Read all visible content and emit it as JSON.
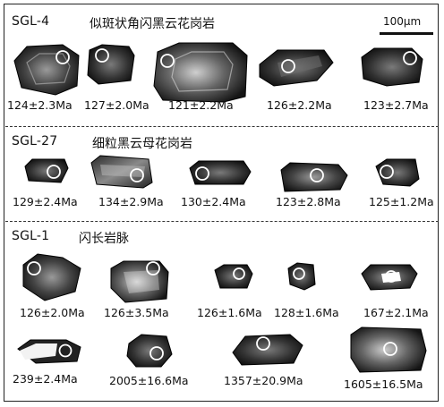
{
  "scale": {
    "label": "100μm"
  },
  "sections": [
    {
      "id": "SGL-4",
      "sample": "SGL-4",
      "rock": "似斑状角闪黑云花岗岩",
      "ages": [
        "124±2.3Ma",
        "127±2.0Ma",
        "121±2.2Ma",
        "126±2.2Ma",
        "123±2.7Ma"
      ]
    },
    {
      "id": "SGL-27",
      "sample": "SGL-27",
      "rock": "细粒黑云母花岗岩",
      "ages": [
        "129±2.4Ma",
        "134±2.9Ma",
        "130±2.4Ma",
        "123±2.8Ma",
        "125±1.2Ma"
      ]
    },
    {
      "id": "SGL-1",
      "sample": "SGL-1",
      "rock": "闪长岩脉",
      "ages": [
        "126±2.0Ma",
        "126±3.5Ma",
        "126±1.6Ma",
        "128±1.6Ma",
        "167±2.1Ma",
        "239±2.4Ma",
        "2005±16.6Ma",
        "1357±20.9Ma",
        "1605±16.5Ma"
      ]
    }
  ]
}
